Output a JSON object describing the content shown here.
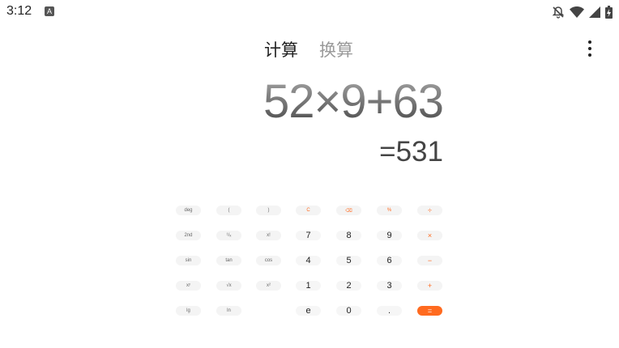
{
  "status_bar": {
    "time": "3:12",
    "notification_badge": "A",
    "icons": [
      "notifications-off-icon",
      "wifi-icon",
      "signal-icon",
      "battery-charging-icon"
    ]
  },
  "tabs": [
    {
      "label": "计算",
      "active": true
    },
    {
      "label": "换算",
      "active": false
    }
  ],
  "display": {
    "expression": "52×9+63",
    "result": "=531"
  },
  "colors": {
    "accent": "#ff6a1f",
    "key_background": "#f4f4f4"
  },
  "keypad": {
    "rows": [
      [
        {
          "label": "deg",
          "type": "fn"
        },
        {
          "label": "(",
          "type": "fn"
        },
        {
          "label": ")",
          "type": "fn"
        },
        {
          "label": "C",
          "type": "op-small"
        },
        {
          "label": "⌫",
          "type": "op-small"
        },
        {
          "label": "%",
          "type": "op-small"
        },
        {
          "label": "÷",
          "type": "op"
        }
      ],
      [
        {
          "label": "2nd",
          "type": "fn"
        },
        {
          "label": "¹/ₓ",
          "type": "fn"
        },
        {
          "label": "x!",
          "type": "fn"
        },
        {
          "label": "7",
          "type": "num"
        },
        {
          "label": "8",
          "type": "num"
        },
        {
          "label": "9",
          "type": "num"
        },
        {
          "label": "×",
          "type": "op"
        }
      ],
      [
        {
          "label": "sin",
          "type": "fn"
        },
        {
          "label": "tan",
          "type": "fn"
        },
        {
          "label": "cos",
          "type": "fn"
        },
        {
          "label": "4",
          "type": "num"
        },
        {
          "label": "5",
          "type": "num"
        },
        {
          "label": "6",
          "type": "num"
        },
        {
          "label": "−",
          "type": "op"
        }
      ],
      [
        {
          "label": "xʸ",
          "type": "fn"
        },
        {
          "label": "√x",
          "type": "fn"
        },
        {
          "label": "x²",
          "type": "fn"
        },
        {
          "label": "1",
          "type": "num"
        },
        {
          "label": "2",
          "type": "num"
        },
        {
          "label": "3",
          "type": "num"
        },
        {
          "label": "+",
          "type": "op"
        }
      ],
      [
        {
          "label": "lg",
          "type": "fn"
        },
        {
          "label": "ln",
          "type": "fn"
        },
        {
          "label": "",
          "type": "empty"
        },
        {
          "label": "e",
          "type": "num"
        },
        {
          "label": "0",
          "type": "num"
        },
        {
          "label": ".",
          "type": "num"
        },
        {
          "label": "=",
          "type": "equal"
        }
      ]
    ]
  }
}
